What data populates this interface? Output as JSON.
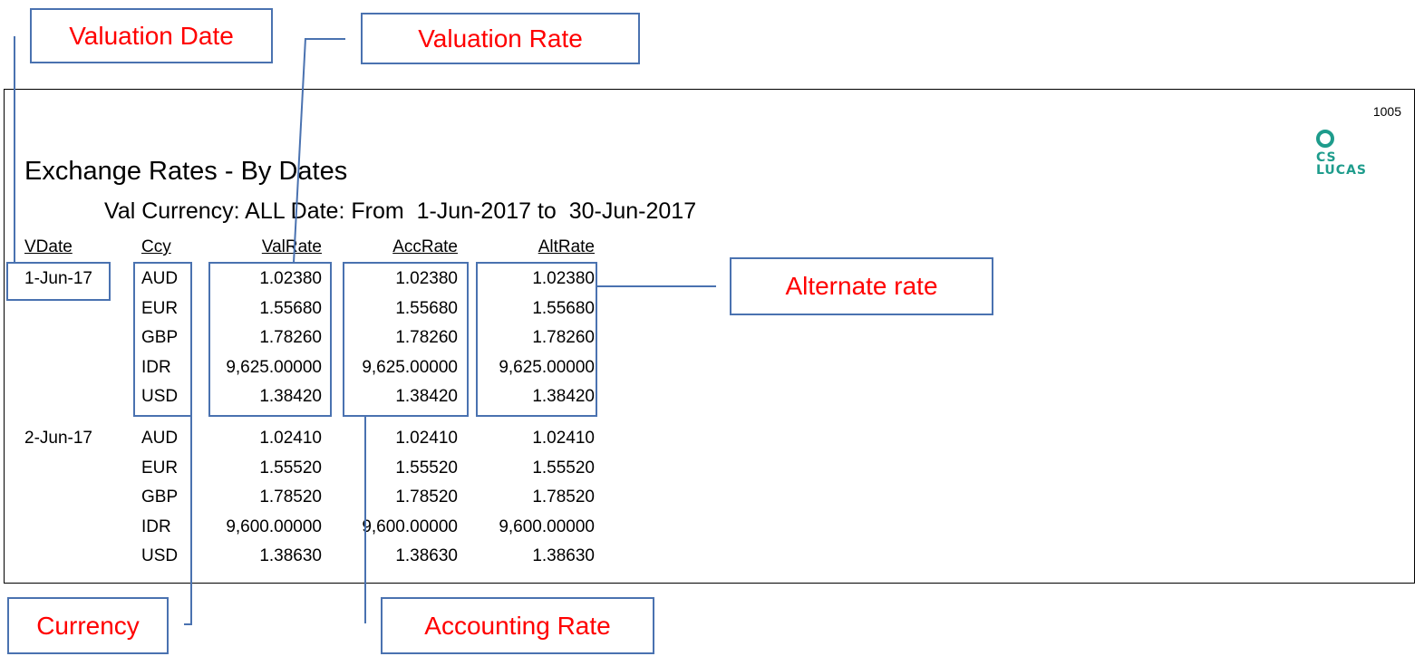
{
  "callouts": {
    "valuation_date": "Valuation Date",
    "valuation_rate": "Valuation Rate",
    "alternate_rate": "Alternate rate",
    "currency": "Currency",
    "accounting_rate": "Accounting Rate"
  },
  "report": {
    "page_number": "1005",
    "logo_line1": "CS",
    "logo_line2": "LUCAS",
    "title": "Exchange Rates - By Dates",
    "subtitle": "Val Currency: ALL Date: From  1-Jun-2017 to  30-Jun-2017",
    "headers": [
      "VDate",
      "Ccy",
      "ValRate",
      "AccRate",
      "AltRate"
    ],
    "groups": [
      {
        "date": "1-Jun-17",
        "rows": [
          {
            "ccy": "AUD",
            "val": "1.02380",
            "acc": "1.02380",
            "alt": "1.02380"
          },
          {
            "ccy": "EUR",
            "val": "1.55680",
            "acc": "1.55680",
            "alt": "1.55680"
          },
          {
            "ccy": "GBP",
            "val": "1.78260",
            "acc": "1.78260",
            "alt": "1.78260"
          },
          {
            "ccy": "IDR",
            "val": "9,625.00000",
            "acc": "9,625.00000",
            "alt": "9,625.00000"
          },
          {
            "ccy": "USD",
            "val": "1.38420",
            "acc": "1.38420",
            "alt": "1.38420"
          }
        ]
      },
      {
        "date": "2-Jun-17",
        "rows": [
          {
            "ccy": "AUD",
            "val": "1.02410",
            "acc": "1.02410",
            "alt": "1.02410"
          },
          {
            "ccy": "EUR",
            "val": "1.55520",
            "acc": "1.55520",
            "alt": "1.55520"
          },
          {
            "ccy": "GBP",
            "val": "1.78520",
            "acc": "1.78520",
            "alt": "1.78520"
          },
          {
            "ccy": "IDR",
            "val": "9,600.00000",
            "acc": "9,600.00000",
            "alt": "9,600.00000"
          },
          {
            "ccy": "USD",
            "val": "1.38630",
            "acc": "1.38630",
            "alt": "1.38630"
          }
        ]
      }
    ]
  }
}
